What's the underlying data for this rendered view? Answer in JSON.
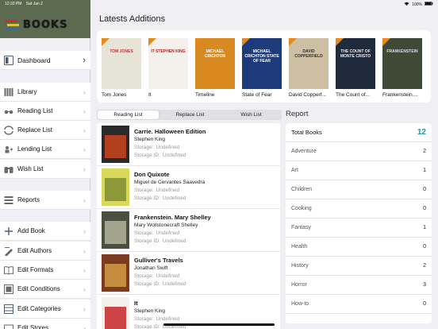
{
  "status_bar": {
    "time": "12:33 PM",
    "date": "Sat Jan 2",
    "battery": "100%"
  },
  "app": {
    "logo_text": "BOOKS"
  },
  "sidebar": {
    "items": [
      {
        "label": "Dashboard",
        "icon": "dashboard-icon",
        "selected": true
      },
      {
        "label": "Library",
        "icon": "library-icon"
      },
      {
        "label": "Reading List",
        "icon": "glasses-icon"
      },
      {
        "label": "Replace List",
        "icon": "replace-icon"
      },
      {
        "label": "Lending List",
        "icon": "lending-icon"
      },
      {
        "label": "Wish List",
        "icon": "binoculars-icon"
      },
      {
        "label": "Reports",
        "icon": "reports-icon"
      },
      {
        "label": "Add Book",
        "icon": "plus-icon"
      },
      {
        "label": "Edit Authors",
        "icon": "author-icon"
      },
      {
        "label": "Edit Formats",
        "icon": "format-icon"
      },
      {
        "label": "Edit Conditions",
        "icon": "conditions-icon"
      },
      {
        "label": "Edit Categories",
        "icon": "categories-icon"
      },
      {
        "label": "Edit Stores",
        "icon": "stores-icon"
      }
    ]
  },
  "latest": {
    "title": "Latests Additions",
    "books": [
      {
        "caption": "Tom Jones",
        "cover_text": "TOM JONES",
        "cover_bg": "#e6e3d7",
        "text_color": "#c33"
      },
      {
        "caption": "It",
        "cover_text": "IT STEPHEN KING",
        "cover_bg": "#f4f1ec",
        "text_color": "#c2191b"
      },
      {
        "caption": "Timeline",
        "cover_text": "MICHAEL CRICHTON",
        "cover_bg": "#d8891f",
        "text_color": "#fff"
      },
      {
        "caption": "State of Fear",
        "cover_text": "MICHAEL CRICHTON STATE OF FEAR",
        "cover_bg": "#1d3a7a",
        "text_color": "#fff"
      },
      {
        "caption": "David Copperf...",
        "cover_text": "DAVID COPPERFIELD",
        "cover_bg": "#cdbfa2",
        "text_color": "#333"
      },
      {
        "caption": "The Count of...",
        "cover_text": "THE COUNT OF MONTE CRISTO",
        "cover_bg": "#1f2a3c",
        "text_color": "#eee"
      },
      {
        "caption": "Frankenstein....",
        "cover_text": "FRANKENSTEIN",
        "cover_bg": "#3e4a36",
        "text_color": "#dde"
      }
    ]
  },
  "tabs": [
    {
      "label": "Reading List",
      "active": true
    },
    {
      "label": "Replace List",
      "active": false
    },
    {
      "label": "Wish List",
      "active": false
    }
  ],
  "reading_list": {
    "storage_label": "Storage:",
    "storage_id_label": "Storage ID:",
    "items": [
      {
        "title": "Carrie. Halloween Edition",
        "author": "Stephen King",
        "storage": "Undefined",
        "storage_id": "Undefined",
        "cover_bg": "#2a2a2a",
        "cover_accent": "#d4451c"
      },
      {
        "title": "Don Quixote",
        "author": "Miguel de Cervantes Saavedra",
        "storage": "Undefined",
        "storage_id": "Undefined",
        "cover_bg": "#d8d85a",
        "cover_accent": "#7a8a30"
      },
      {
        "title": "Frankenstein. Mary Shelley",
        "author": "Mary Wollstonecraft Shelley",
        "storage": "Undefined",
        "storage_id": "Undefined",
        "cover_bg": "#4a5040",
        "cover_accent": "#b9b9a0"
      },
      {
        "title": "Gulliver's Travels",
        "author": "Jonathan Swift",
        "storage": "Undefined",
        "storage_id": "Undefined",
        "cover_bg": "#7a3b22",
        "cover_accent": "#d9a24a"
      },
      {
        "title": "It",
        "author": "Stephen King",
        "storage": "Undefined",
        "storage_id": "Undefined",
        "cover_bg": "#f4f1ec",
        "cover_accent": "#c2191b"
      }
    ]
  },
  "report": {
    "title": "Report",
    "rows": [
      {
        "label": "Total Books",
        "value": "12"
      },
      {
        "label": "Adventure",
        "value": "2"
      },
      {
        "label": "Art",
        "value": "1"
      },
      {
        "label": "Children",
        "value": "0"
      },
      {
        "label": "Cooking",
        "value": "0"
      },
      {
        "label": "Fantasy",
        "value": "1"
      },
      {
        "label": "Health",
        "value": "0"
      },
      {
        "label": "History",
        "value": "2"
      },
      {
        "label": "Horror",
        "value": "3"
      },
      {
        "label": "How-to",
        "value": "0"
      }
    ]
  },
  "colors": {
    "accent": "#1c9ba0",
    "banner": "#5c6b4f",
    "corner": "#e8891c"
  }
}
